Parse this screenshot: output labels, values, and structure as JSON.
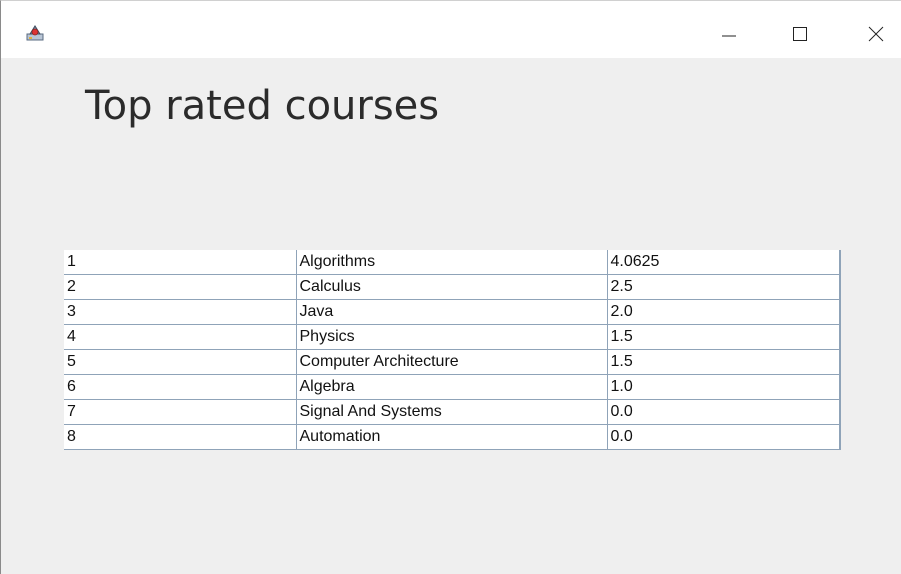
{
  "window": {
    "controls": {
      "minimize_icon": "minimize-icon",
      "maximize_icon": "maximize-icon",
      "close_icon": "close-icon"
    },
    "app_icon": "java-app-icon"
  },
  "main": {
    "title": "Top rated courses"
  },
  "table": {
    "rows": [
      {
        "rank": "1",
        "course": "Algorithms",
        "rating": "4.0625"
      },
      {
        "rank": "2",
        "course": "Calculus",
        "rating": "2.5"
      },
      {
        "rank": "3",
        "course": "Java",
        "rating": "2.0"
      },
      {
        "rank": "4",
        "course": "Physics",
        "rating": "1.5"
      },
      {
        "rank": "5",
        "course": "Computer Architecture",
        "rating": "1.5"
      },
      {
        "rank": "6",
        "course": "Algebra",
        "rating": "1.0"
      },
      {
        "rank": "7",
        "course": "Signal And Systems",
        "rating": "0.0"
      },
      {
        "rank": "8",
        "course": "Automation",
        "rating": "0.0"
      }
    ]
  },
  "colors": {
    "window_bg": "#efefef",
    "titlebar_bg": "#ffffff",
    "grid_line": "#8fa3b8"
  }
}
